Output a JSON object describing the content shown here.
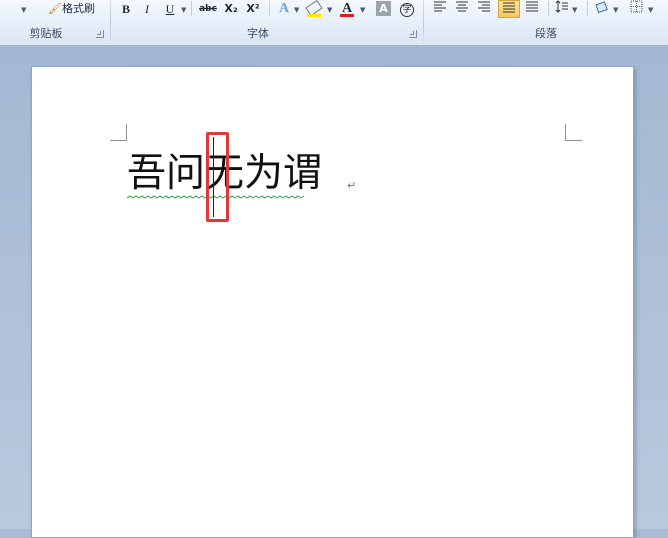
{
  "ribbon": {
    "clipboard": {
      "label": "剪贴板",
      "format_painter": "格式刷"
    },
    "font": {
      "label": "字体",
      "bold": "B",
      "italic": "I",
      "underline": "U",
      "strikethrough": "abc",
      "subscript": "X₂",
      "superscript": "X²",
      "font_color": "A",
      "char_shading": "A"
    },
    "paragraph": {
      "label": "段落"
    }
  },
  "document": {
    "text": "吾问无为谓",
    "paragraph_mark": "↵"
  },
  "colors": {
    "highlight_box": "#e0393a",
    "font_color_bar": "#e02020",
    "highlighter_bar": "#ffe800"
  }
}
